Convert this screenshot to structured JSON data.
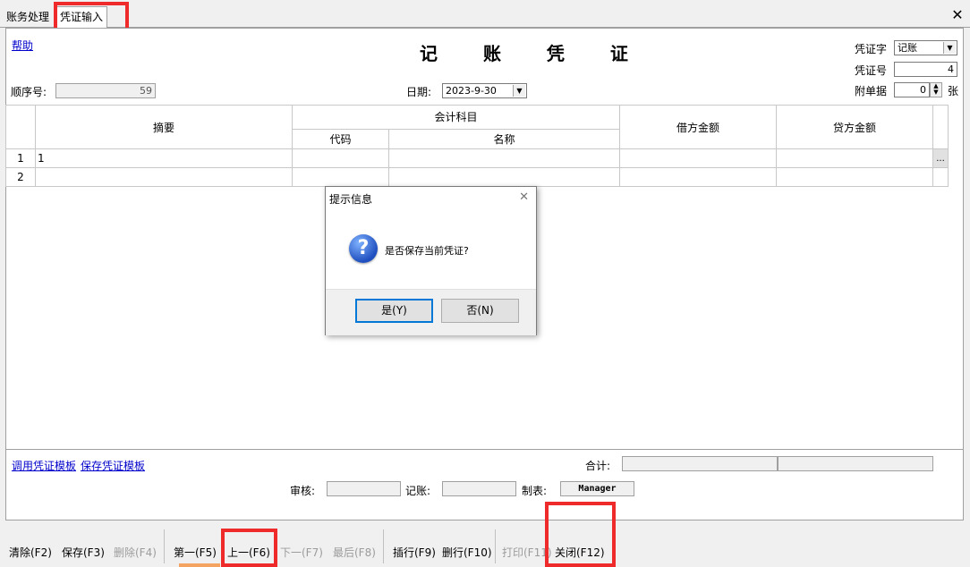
{
  "tabs": [
    {
      "label": "账务处理"
    },
    {
      "label": "凭证输入"
    }
  ],
  "window": {
    "close_glyph": "✕"
  },
  "voucher": {
    "help_link": "帮助",
    "title": "记 账 凭 证",
    "seq_label": "顺序号:",
    "seq_value": "59",
    "date_label": "日期:",
    "date_value": "2023-9-30",
    "type_label": "凭证字",
    "type_value": "记账",
    "number_label": "凭证号",
    "number_value": "4",
    "attach_label": "附单据",
    "attach_value": "0",
    "attach_unit": "张"
  },
  "grid": {
    "col_summary": "摘要",
    "col_account": "会计科目",
    "col_code": "代码",
    "col_name": "名称",
    "col_debit": "借方金额",
    "col_credit": "贷方金额",
    "rows": [
      {
        "no": "1",
        "summary": "1",
        "code": "",
        "name": "",
        "debit": "",
        "credit": ""
      },
      {
        "no": "2",
        "summary": "",
        "code": "",
        "name": "",
        "debit": "",
        "credit": ""
      }
    ],
    "ellipsis": "..."
  },
  "footer": {
    "use_template": "调用凭证模板",
    "save_template": "保存凭证模板",
    "total_label": "合计:",
    "audit_label": "审核:",
    "post_label": "记账:",
    "maker_label": "制表:",
    "maker_value": "Manager"
  },
  "toolbar": {
    "clear": "清除(F2)",
    "save": "保存(F3)",
    "delete": "删除(F4)",
    "first": "第一(F5)",
    "prev": "上一(F6)",
    "next": "下一(F7)",
    "last": "最后(F8)",
    "insert_row": "插行(F9)",
    "delete_row": "删行(F10)",
    "print": "打印(F11)",
    "close": "关闭(F12)"
  },
  "dialog": {
    "title": "提示信息",
    "message": "是否保存当前凭证?",
    "yes": "是(Y)",
    "no": "否(N)",
    "close_glyph": "✕"
  },
  "colors": {
    "highlight": "#ee2a2a",
    "link": "#0000cc",
    "dialog_default_border": "#0078d7"
  }
}
